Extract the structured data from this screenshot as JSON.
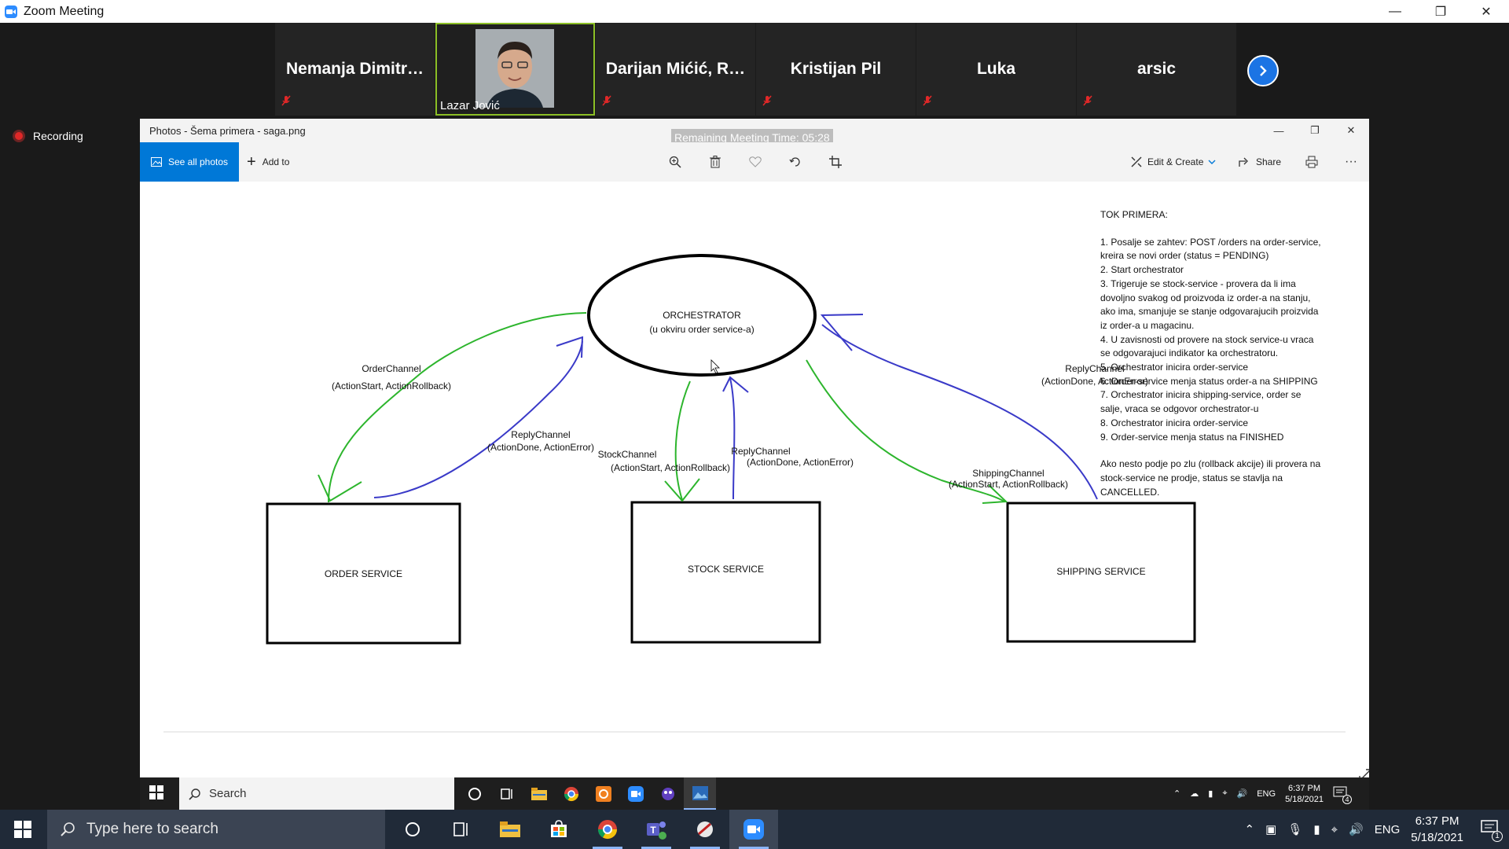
{
  "zoom": {
    "window_title": "Zoom Meeting",
    "recording_label": "Recording",
    "participants": [
      {
        "name": "Nemanja  Dimitr…",
        "muted": true
      },
      {
        "name": "Lazar Jović",
        "video": true
      },
      {
        "name": "Darijan  Mićić, R…",
        "muted": true
      },
      {
        "name": "Kristijan Pil",
        "muted": true
      },
      {
        "name": "Luka",
        "muted": true
      },
      {
        "name": "arsic",
        "muted": true
      }
    ]
  },
  "photos": {
    "window_title": "Photos - Šema primera - saga.png",
    "remaining_time": "Remaining Meeting Time: 05:28",
    "see_all_label": "See all photos",
    "add_to_label": "Add to",
    "edit_create_label": "Edit & Create",
    "share_label": "Share"
  },
  "diagram": {
    "orchestrator_title": "ORCHESTRATOR",
    "orchestrator_subtitle": "(u okviru order service-a)",
    "order_service": "ORDER SERVICE",
    "stock_service": "STOCK SERVICE",
    "shipping_service": "SHIPPING SERVICE",
    "order_channel": "OrderChannel",
    "order_channel_actions": "(ActionStart, ActionRollback)",
    "reply_channel_order": "ReplyChannel",
    "reply_channel_order_actions": "(ActionDone, ActionError)",
    "stock_channel": "StockChannel",
    "stock_channel_actions": "(ActionStart, ActionRollback)",
    "reply_channel_stock": "ReplyChannel",
    "reply_channel_stock_actions": "(ActionDone, ActionError)",
    "shipping_channel": "ShippingChannel",
    "shipping_channel_actions": "(ActionStart, ActionRollback)",
    "reply_channel_shipping": "ReplyChannel",
    "reply_channel_shipping_actions": "(ActionDone, ActionError)",
    "notes_title": "TOK PRIMERA:",
    "notes_lines": [
      "1. Posalje se zahtev: POST /orders na order-service,",
      "kreira se novi order (status = PENDING)",
      "2. Start orchestrator",
      "3. Trigeruje se stock-service - provera da li ima",
      "dovoljno svakog od proizvoda iz order-a na stanju,",
      "ako ima, smanjuje se stanje odgovarajucih proizvida",
      "iz order-a u magacinu.",
      "4.  U zavisnosti od provere na stock service-u vraca",
      "se odgovarajuci indikator ka orchestratoru.",
      "5. Orchestrator inicira order-service",
      "6. Order-service menja status order-a na SHIPPING",
      "7. Orchestrator inicira shipping-service, order se",
      "salje, vraca se odgovor orchestrator-u",
      "8. Orchestrator inicira order-service",
      "9. Order-service menja status na FINISHED"
    ],
    "notes_footer_lines": [
      "Ako nesto podje po zlu (rollback akcije) ili provera na",
      "stock-service ne prodje, status se stavlja na",
      "CANCELLED."
    ],
    "colors": {
      "request": "#2db52d",
      "reply": "#3a3ac8"
    }
  },
  "inner_taskbar": {
    "search_label": "Search",
    "tray_lang": "ENG",
    "time": "6:37 PM",
    "date": "5/18/2021",
    "notification_count": "4"
  },
  "taskbar": {
    "search_placeholder": "Type here to search",
    "tray_lang": "ENG",
    "time": "6:37 PM",
    "date": "5/18/2021",
    "notification_count": "1"
  }
}
